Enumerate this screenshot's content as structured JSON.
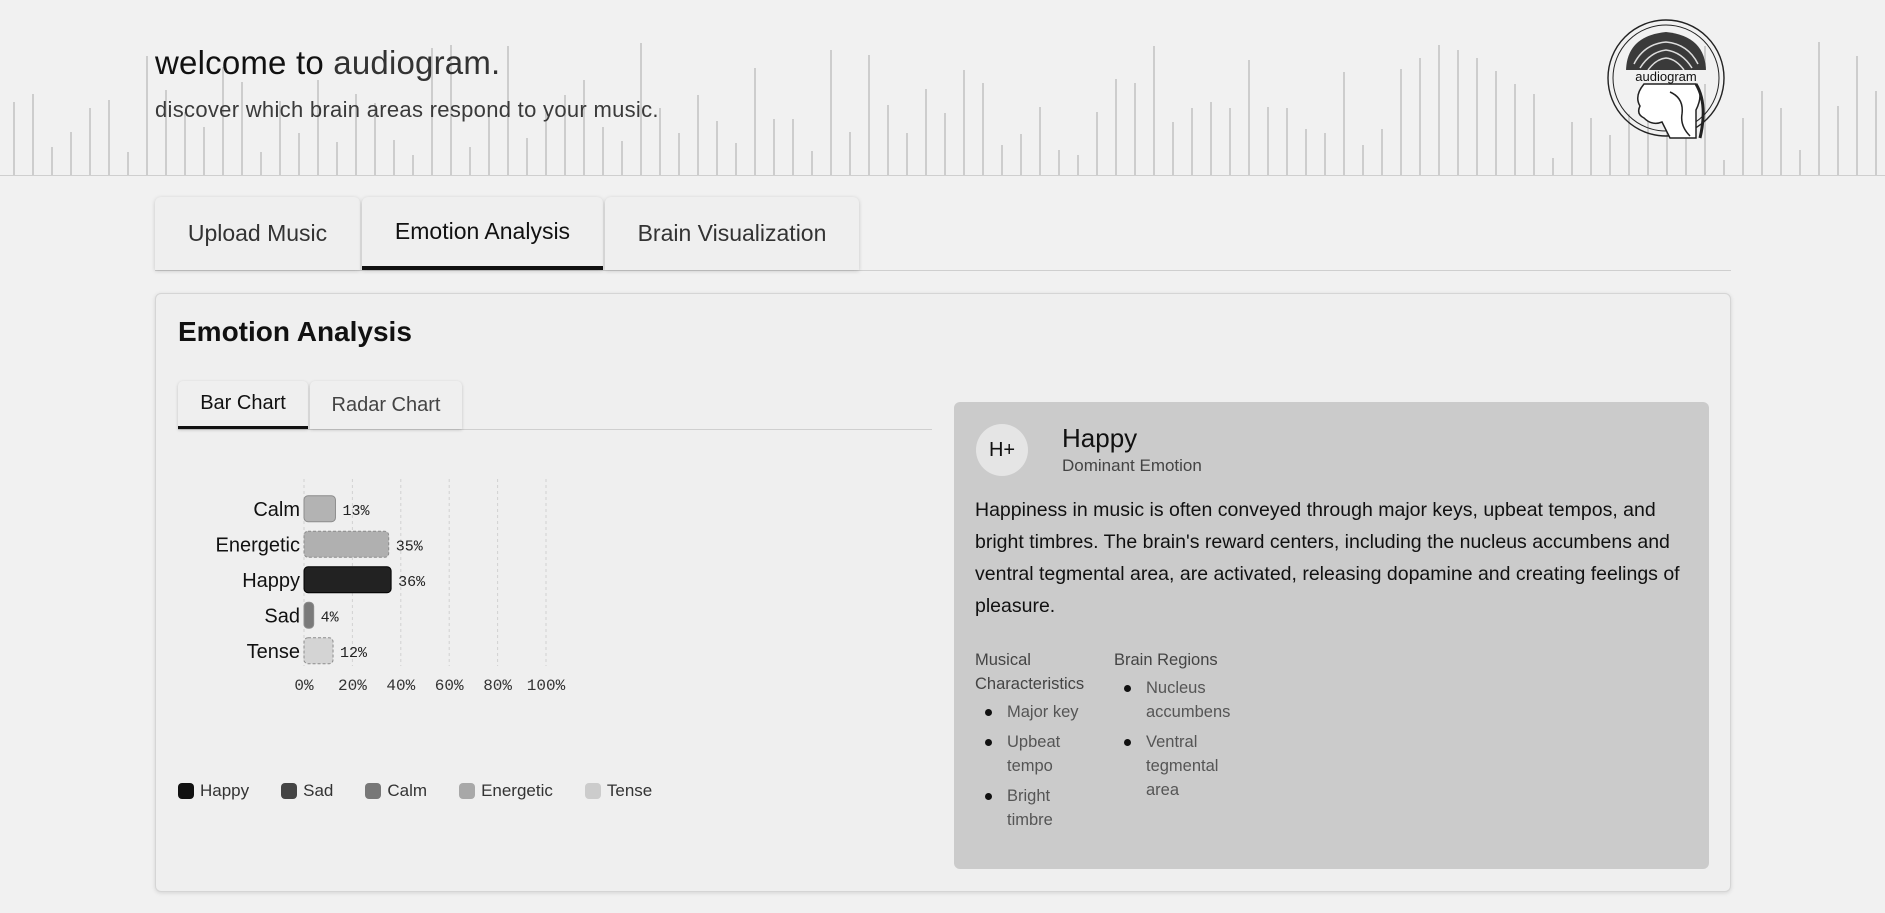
{
  "header": {
    "title_prefix": "welcome to ",
    "title_brand": "audiogram.",
    "subtitle": "discover which brain areas respond to your music.",
    "logo_text": "audiogram"
  },
  "main_tabs": [
    {
      "label": "Upload Music",
      "active": false
    },
    {
      "label": "Emotion Analysis",
      "active": true
    },
    {
      "label": "Brain Visualization",
      "active": false
    }
  ],
  "card": {
    "title": "Emotion Analysis",
    "sub_tabs": [
      {
        "label": "Bar Chart",
        "active": true
      },
      {
        "label": "Radar Chart",
        "active": false
      }
    ]
  },
  "chart_data": {
    "type": "bar",
    "orientation": "horizontal",
    "categories": [
      "Calm",
      "Energetic",
      "Happy",
      "Sad",
      "Tense"
    ],
    "values": [
      13,
      35,
      36,
      4,
      12
    ],
    "value_labels": [
      "13%",
      "35%",
      "36%",
      "4%",
      "12%"
    ],
    "colors": [
      "#b3b3b3",
      "#b0b0b0",
      "#222222",
      "#7a7a7a",
      "#d4d4d4"
    ],
    "x_ticks": [
      "0%",
      "20%",
      "40%",
      "60%",
      "80%",
      "100%"
    ],
    "xlim": [
      0,
      100
    ],
    "grid": true,
    "legend": [
      {
        "label": "Happy",
        "color": "#111111"
      },
      {
        "label": "Sad",
        "color": "#444444"
      },
      {
        "label": "Calm",
        "color": "#777777"
      },
      {
        "label": "Energetic",
        "color": "#a8a8a8"
      },
      {
        "label": "Tense",
        "color": "#cccccc"
      }
    ],
    "legend_position": "bottom"
  },
  "detail": {
    "badge": "H+",
    "emotion": "Happy",
    "caption": "Dominant Emotion",
    "description": "Happiness in music is often conveyed through major keys, upbeat tempos, and bright timbres. The brain's reward centers, including the nucleus accumbens and ventral tegmental area, are activated, releasing dopamine and creating feelings of pleasure.",
    "musical_title": "Musical Characteristics",
    "musical_items": [
      "Major key",
      "Upbeat tempo",
      "Bright timbre"
    ],
    "brain_title": "Brain Regions",
    "brain_items": [
      "Nucleus accumbens",
      "Ventral tegmental area"
    ]
  }
}
